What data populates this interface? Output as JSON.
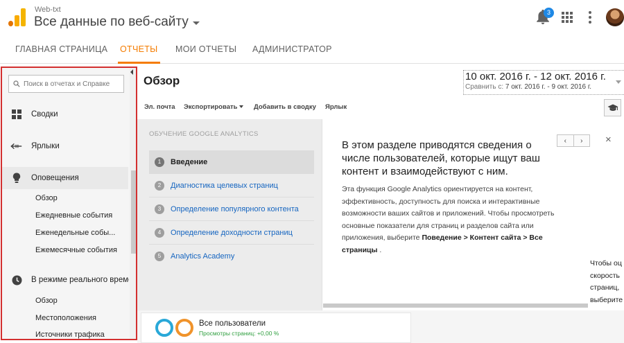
{
  "header": {
    "account": "Web-txt",
    "property": "Все данные по веб-сайту",
    "notifications_count": "3",
    "colors": {
      "brand": "#f9ab00",
      "badge": "#1e88e5"
    },
    "icons": [
      "analytics-logo-icon",
      "bell-icon",
      "apps-grid-icon",
      "more-vert-icon",
      "avatar"
    ]
  },
  "topnav": {
    "tabs": [
      {
        "label": "ГЛАВНАЯ СТРАНИЦА"
      },
      {
        "label": "ОТЧЕТЫ",
        "active": true
      },
      {
        "label": "МОИ ОТЧЕТЫ"
      },
      {
        "label": "АДМИНИСТРАТОР"
      }
    ],
    "active_color": "#f57c00"
  },
  "sidebar": {
    "search_placeholder": "Поиск в отчетах и Справке",
    "items": [
      {
        "label": "Сводки",
        "icon": "dashboard-grid-icon"
      },
      {
        "label": "Ярлыки",
        "icon": "shortcut-arrow-icon"
      },
      {
        "label": "Оповещения",
        "icon": "lightbulb-icon",
        "selected": true
      },
      {
        "label": "В режиме реального времени",
        "icon": "clock-icon"
      }
    ],
    "alerts_sub": [
      "Обзор",
      "Ежедневные события",
      "Еженедельные собы...",
      "Ежемесячные события"
    ],
    "realtime_sub": [
      "Обзор",
      "Местоположения",
      "Источники трафика"
    ]
  },
  "main": {
    "title": "Обзор",
    "date_range": "10 окт. 2016 г. - 12 окт. 2016 г.",
    "compare_label": "Сравнить с:",
    "compare_range": "7 окт. 2016 г. - 9 окт. 2016 г.",
    "toolbar": {
      "email": "Эл. почта",
      "export": "Экспортировать",
      "add_to_dashboard": "Добавить в сводку",
      "shortcut": "Ярлык"
    }
  },
  "onboarding": {
    "heading": "ОБУЧЕНИЕ GOOGLE ANALYTICS",
    "steps": [
      {
        "num": "1",
        "label": "Введение",
        "active": true
      },
      {
        "num": "2",
        "label": "Диагностика целевых страниц"
      },
      {
        "num": "3",
        "label": "Определение популярного контента"
      },
      {
        "num": "4",
        "label": "Определение доходности страниц"
      },
      {
        "num": "5",
        "label": "Analytics Academy"
      }
    ],
    "title": "В этом разделе приводятся сведения о числе пользователей, которые ищут ваш контент и взаимодействуют с ним.",
    "body_text": "Эта функция Google Analytics ориентируется на контент, эффективность, доступность для поиска и интерактивные возможности ваших сайтов и приложений. Чтобы просмотреть основные показатели для страниц и разделов сайта или приложения, выберите",
    "body_path": "Поведение > Контент сайта > Все страницы",
    "body_end": ".",
    "overflow_lines": [
      "Чтобы оц",
      "скорость",
      "страниц,",
      "выберите"
    ],
    "prev": "‹",
    "next": "›",
    "close": "×"
  },
  "card": {
    "title": "Все пользователи",
    "subtitle": "Просмотры страниц: +0,00 %",
    "colors": {
      "ring1": "#29a8d8",
      "ring2": "#f0932b",
      "positive": "#2e9e3e"
    }
  }
}
